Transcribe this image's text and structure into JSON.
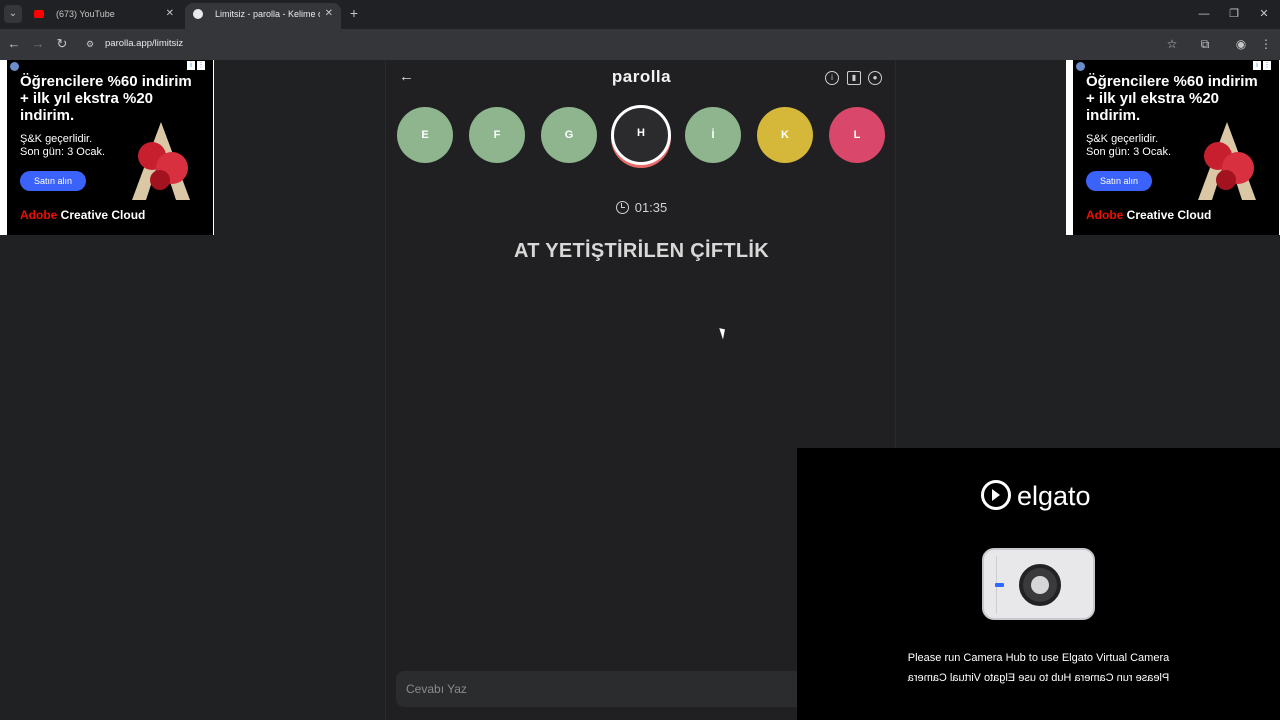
{
  "browser": {
    "tabs": [
      {
        "title": "(673) YouTube",
        "active": false
      },
      {
        "title": "Limitsiz - parolla - Kelime oyunu",
        "active": true
      }
    ],
    "new_tab": "+",
    "url": "parolla.app/limitsiz",
    "window_controls": {
      "minimize": "—",
      "restore": "❐",
      "close": "✕"
    }
  },
  "ads": [
    {
      "headline": "Öğrencilere %60 indirim + ilk yıl ekstra %20 indirim.",
      "sub1": "Ş&K geçerlidir.",
      "sub2": "Son gün: 3 Ocak.",
      "button": "Satın alın",
      "brand_red": "Adobe",
      "brand_white": " Creative Cloud"
    },
    {
      "headline": "Öğrencilere %60 indirim + ilk yıl ekstra %20 indirim.",
      "sub1": "Ş&K geçerlidir.",
      "sub2": "Son gün: 3 Ocak.",
      "button": "Satın alın",
      "brand_red": "Adobe",
      "brand_white": " Creative Cloud"
    }
  ],
  "game": {
    "logo": "parolla",
    "header_icons": [
      "info-icon",
      "stats-icon",
      "profile-icon"
    ],
    "letters": [
      {
        "letter": "E",
        "state": "correct"
      },
      {
        "letter": "F",
        "state": "correct"
      },
      {
        "letter": "G",
        "state": "correct"
      },
      {
        "letter": "H",
        "state": "current"
      },
      {
        "letter": "İ",
        "state": "correct"
      },
      {
        "letter": "K",
        "state": "passed"
      },
      {
        "letter": "L",
        "state": "wrong"
      }
    ],
    "timer": "01:35",
    "question": "AT YETİŞTİRİLEN ÇİFTLİK",
    "answer_placeholder": "Cevabı Yaz"
  },
  "elgato": {
    "brand": "elgato",
    "message": "Please run Camera Hub to use Elgato Virtual Camera"
  },
  "colors": {
    "correct": "#8fb58e",
    "passed": "#d5b83a",
    "wrong": "#d9476a",
    "adobe_red": "#eb1000",
    "ad_button": "#3b63fb"
  }
}
